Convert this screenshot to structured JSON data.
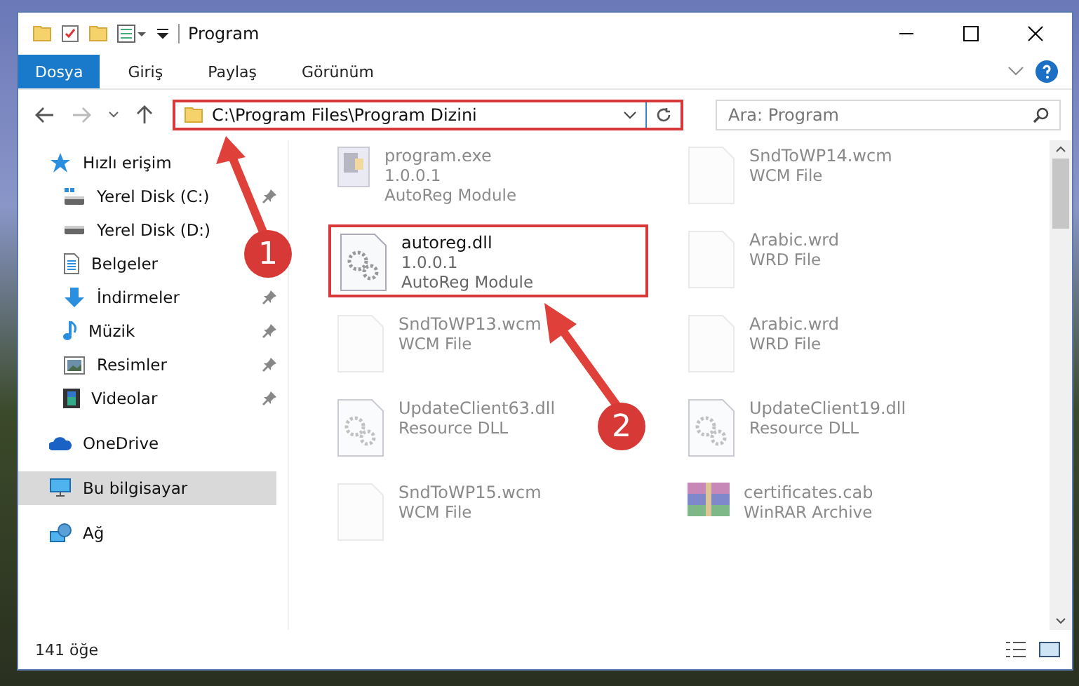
{
  "window": {
    "title": "Program"
  },
  "ribbon_tabs": [
    {
      "label": "Dosya",
      "selected": true
    },
    {
      "label": "Giriş",
      "selected": false
    },
    {
      "label": "Paylaş",
      "selected": false
    },
    {
      "label": "Görünüm",
      "selected": false
    }
  ],
  "address_bar": {
    "path": "C:\\Program Files\\Program Dizini",
    "highlighted": true
  },
  "search": {
    "placeholder": "Ara: Program"
  },
  "sidebar": {
    "items": [
      {
        "label": "Hızlı erişim",
        "pinned": false,
        "selected": false,
        "children": [
          {
            "label": "Yerel Disk (C:)",
            "pinned": true,
            "selected": false
          },
          {
            "label": "Yerel Disk (D:)",
            "pinned": false,
            "selected": false
          },
          {
            "label": "Belgeler",
            "pinned": false,
            "selected": false
          },
          {
            "label": "İndirmeler",
            "pinned": true,
            "selected": false
          },
          {
            "label": "Müzik",
            "pinned": true,
            "selected": false
          },
          {
            "label": "Resimler",
            "pinned": true,
            "selected": false
          },
          {
            "label": "Videolar",
            "pinned": true,
            "selected": false
          }
        ]
      },
      {
        "label": "OneDrive",
        "pinned": false,
        "selected": false
      },
      {
        "label": "Bu bilgisayar",
        "pinned": false,
        "selected": true
      },
      {
        "label": "Ağ",
        "pinned": false,
        "selected": false
      }
    ]
  },
  "files": [
    {
      "name": "program.exe",
      "lines": [
        "1.0.0.1",
        "AutoReg Module"
      ],
      "kind": "app",
      "dimmed": true,
      "highlighted": false
    },
    {
      "name": "SndToWP14.wcm",
      "lines": [
        "WCM File"
      ],
      "kind": "blank",
      "dimmed": true,
      "highlighted": false
    },
    {
      "name": "autoreg.dll",
      "lines": [
        "1.0.0.1",
        "AutoReg Module"
      ],
      "kind": "gears",
      "dimmed": false,
      "highlighted": true
    },
    {
      "name": "Arabic.wrd",
      "lines": [
        "WRD File"
      ],
      "kind": "blank",
      "dimmed": true,
      "highlighted": false
    },
    {
      "name": "SndToWP13.wcm",
      "lines": [
        "WCM File"
      ],
      "kind": "blank",
      "dimmed": true,
      "highlighted": false
    },
    {
      "name": "Arabic.wrd",
      "lines": [
        "WRD File"
      ],
      "kind": "blank",
      "dimmed": true,
      "highlighted": false
    },
    {
      "name": "UpdateClient63.dll",
      "lines": [
        "Resource DLL"
      ],
      "kind": "gears",
      "dimmed": true,
      "highlighted": false
    },
    {
      "name": "UpdateClient19.dll",
      "lines": [
        "Resource DLL"
      ],
      "kind": "gears",
      "dimmed": true,
      "highlighted": false
    },
    {
      "name": "SndToWP15.wcm",
      "lines": [
        "WCM File"
      ],
      "kind": "blank",
      "dimmed": true,
      "highlighted": false
    },
    {
      "name": "certificates.cab",
      "lines": [
        "WinRAR Archive"
      ],
      "kind": "archive",
      "dimmed": true,
      "highlighted": false
    }
  ],
  "status_bar": {
    "count": "141 öğe"
  },
  "annotations": [
    {
      "number": "1"
    },
    {
      "number": "2"
    }
  ]
}
